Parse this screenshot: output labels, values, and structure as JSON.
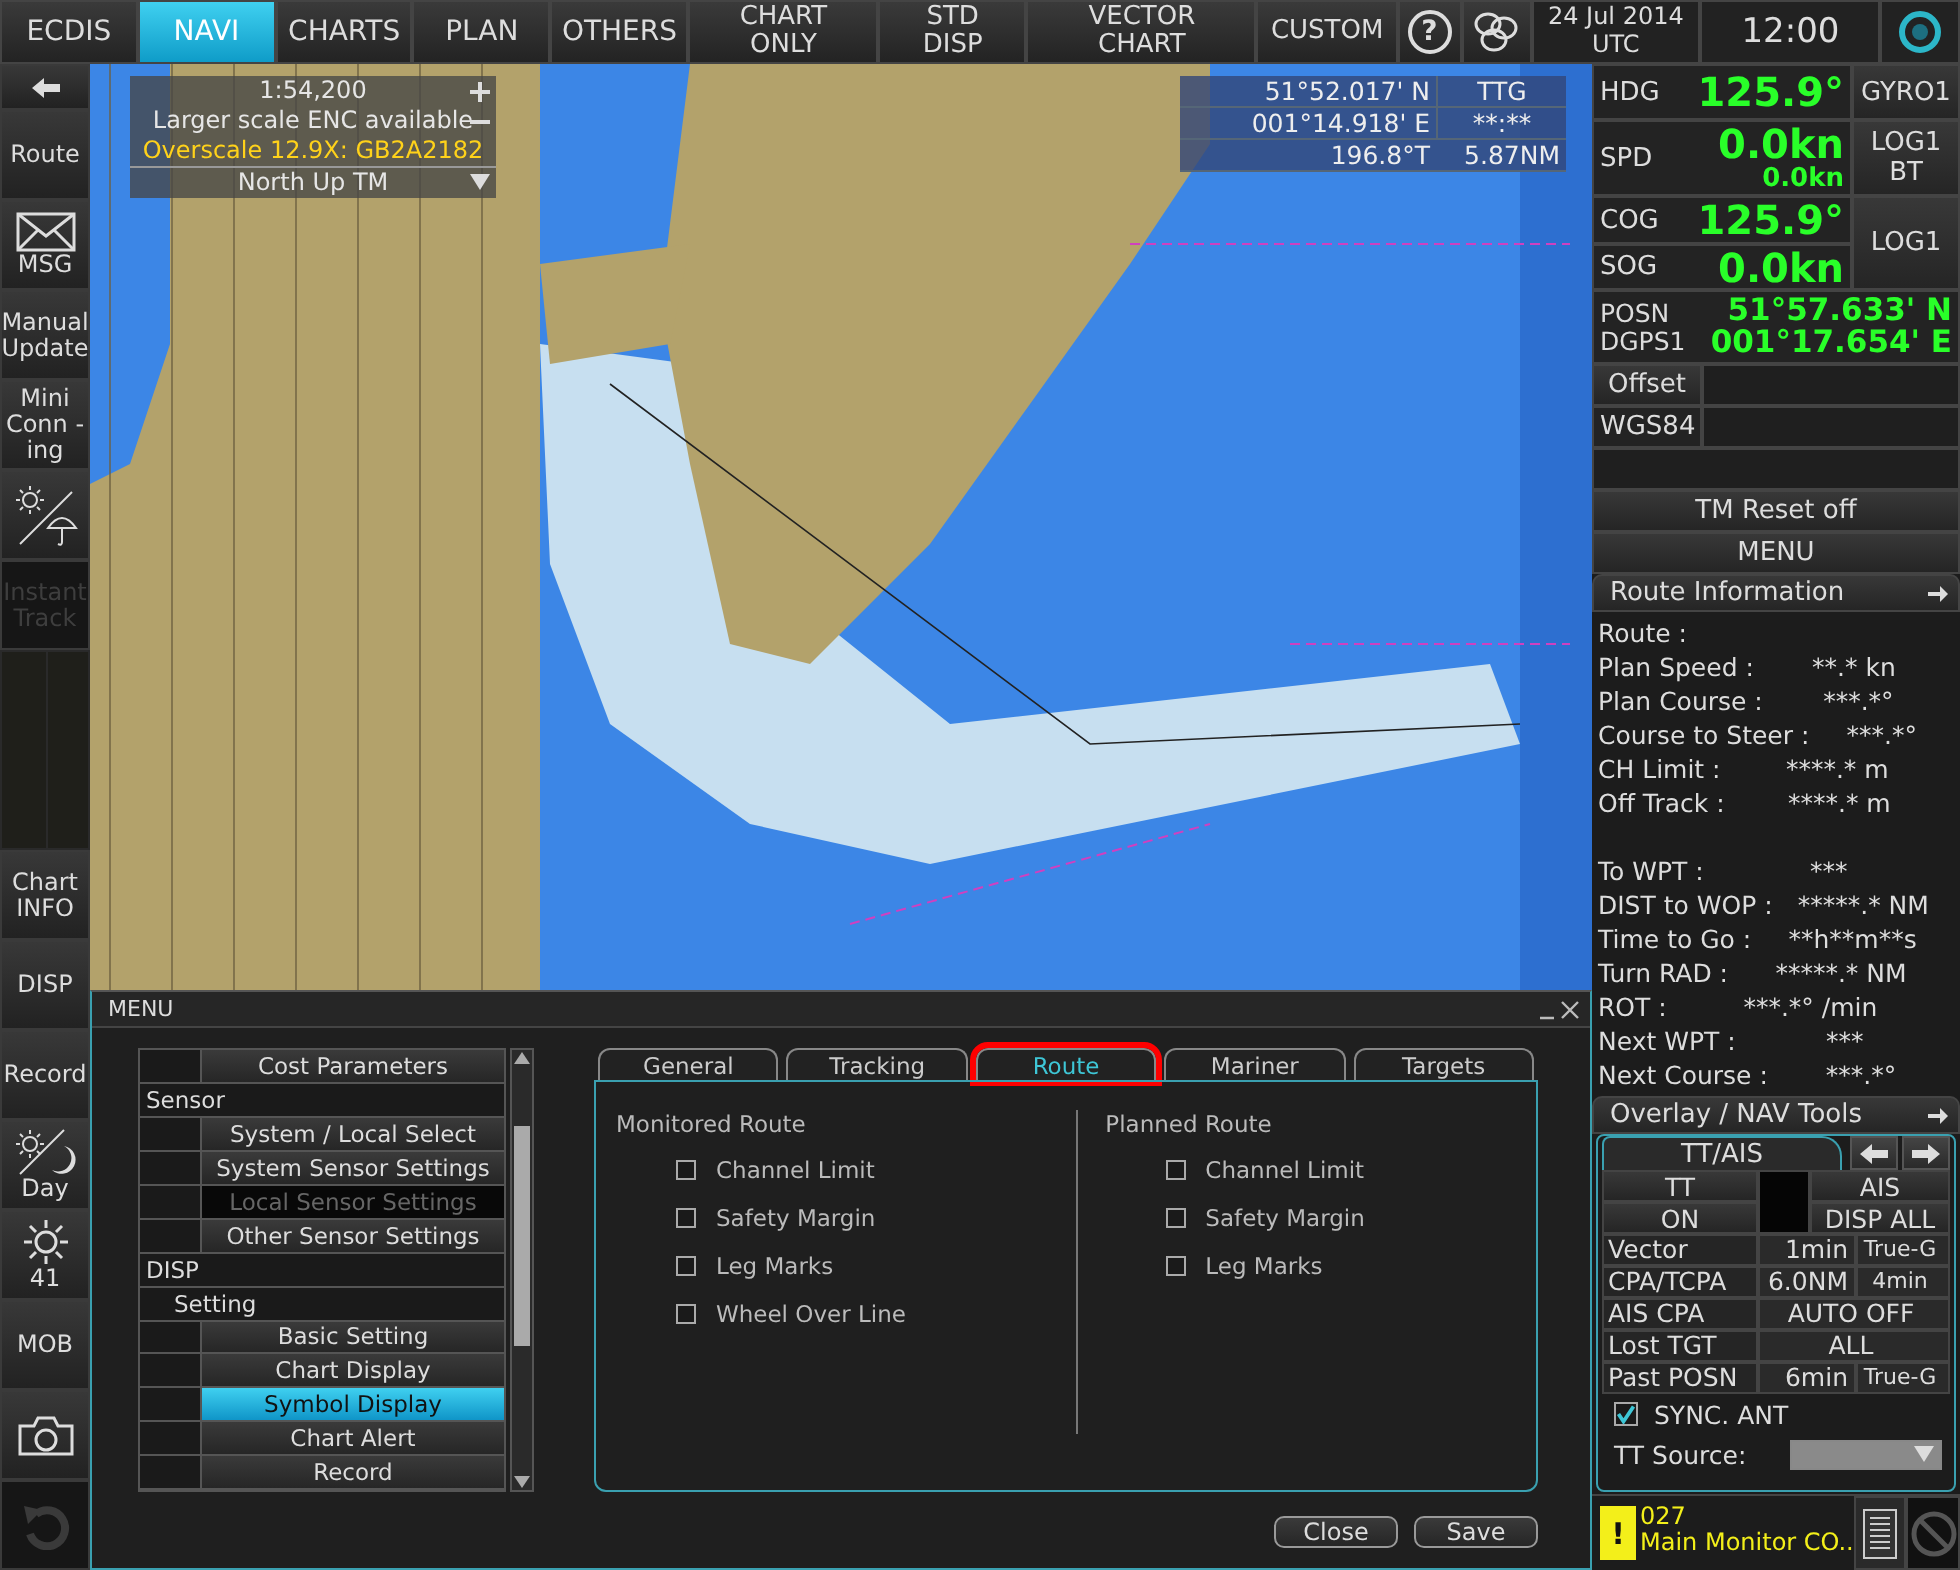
{
  "top_bar": {
    "tabs": [
      {
        "label": "ECDIS",
        "selected": false
      },
      {
        "label": "NAVI",
        "selected": true
      },
      {
        "label": "CHARTS",
        "selected": false
      },
      {
        "label": "PLAN",
        "selected": false
      },
      {
        "label": "OTHERS",
        "selected": false
      }
    ],
    "display_buttons": [
      "CHART ONLY",
      "STD DISP",
      "VECTOR CHART",
      "CUSTOM"
    ],
    "help_button": "?",
    "date": "24 Jul 2014",
    "timezone": "UTC",
    "time": "12:00"
  },
  "left_sidebar": {
    "upper_buttons": [
      {
        "kind": "arrow",
        "disabled": false
      },
      {
        "kind": "text",
        "label": "Route",
        "disabled": false
      },
      {
        "kind": "mail",
        "label": "MSG",
        "disabled": false
      },
      {
        "kind": "text",
        "label": "Manual Update",
        "disabled": false
      },
      {
        "kind": "text",
        "label": "Mini Conn -ing",
        "disabled": false
      },
      {
        "kind": "weather",
        "disabled": false
      },
      {
        "kind": "text",
        "label": "Instant Track",
        "disabled": true
      }
    ],
    "lower_buttons": [
      {
        "kind": "text",
        "label": "Chart INFO",
        "disabled": false
      },
      {
        "kind": "text",
        "label": "DISP",
        "disabled": false
      },
      {
        "kind": "text",
        "label": "Record",
        "disabled": false
      },
      {
        "kind": "daynight",
        "label": "Day",
        "disabled": false
      },
      {
        "kind": "brightness",
        "label": "41",
        "disabled": false
      },
      {
        "kind": "text",
        "label": "MOB",
        "disabled": false
      },
      {
        "kind": "camera",
        "disabled": false
      },
      {
        "kind": "undo",
        "disabled": true
      }
    ]
  },
  "chart": {
    "scale_box": {
      "scale": "1:54,200",
      "notice": "Larger scale ENC available",
      "overscale": "Overscale 12.9X: GB2A2182",
      "orientation": "North Up TM"
    },
    "cursor_box": {
      "lat": "51°52.017' N",
      "lon": "001°14.918' E",
      "bearing": "196.8°T",
      "range": "5.87NM",
      "ttg_label": "TTG",
      "ttg": "**:**"
    }
  },
  "sensors": {
    "hdg": {
      "label": "HDG",
      "value": "125.9°",
      "source": "GYRO1"
    },
    "spd": {
      "label": "SPD",
      "value": "0.0kn",
      "sub_value": "0.0kn",
      "source": "LOG1 BT"
    },
    "cog": {
      "label": "COG",
      "value": "125.9°"
    },
    "sog": {
      "label": "SOG",
      "value": "0.0kn"
    },
    "cog_sog_source": "LOG1",
    "position": {
      "label": "POSN",
      "source": "DGPS1",
      "lat": "51°57.633' N",
      "lon": "001°17.654' E"
    },
    "offset_button": "Offset",
    "datum": "WGS84"
  },
  "tm_reset_button": "TM Reset off",
  "menu_button": "MENU",
  "route_information": {
    "title": "Route Information",
    "rows": [
      {
        "label": "Route :"
      },
      {
        "label": "Plan Speed :",
        "value": "**.* kn"
      },
      {
        "label": "Plan Course :",
        "value": "***.*°"
      },
      {
        "label": "Course to Steer :",
        "value": "***.*°"
      },
      {
        "label": "CH Limit :",
        "value": "****.* m"
      },
      {
        "label": "Off Track :",
        "value": "****.* m"
      }
    ],
    "waypoint_rows": [
      {
        "label": "To WPT :",
        "value": "***"
      },
      {
        "label": "DIST to WOP :",
        "value": "*****.* NM"
      },
      {
        "label": "Time to Go :",
        "value": "**h**m**s"
      },
      {
        "label": "Turn RAD :",
        "value": "*****.* NM"
      },
      {
        "label": "ROT :",
        "value": "***.*° /min"
      },
      {
        "label": "Next WPT :",
        "value": "***"
      },
      {
        "label": "Next Course :",
        "value": "***.*°"
      }
    ]
  },
  "overlay_nav_tools": {
    "title": "Overlay / NAV Tools",
    "tab": "TT/AIS",
    "toggles": [
      {
        "label": "TT",
        "state": "ON"
      },
      {
        "label": "AIS",
        "state": "DISP ALL"
      }
    ],
    "settings": [
      {
        "label": "Vector",
        "values": [
          "1min",
          "True-G"
        ]
      },
      {
        "label": "CPA/TCPA",
        "values": [
          "6.0NM",
          "4min"
        ]
      },
      {
        "label": "AIS CPA",
        "values": [
          "AUTO OFF"
        ]
      },
      {
        "label": "Lost TGT",
        "values": [
          "ALL"
        ]
      },
      {
        "label": "Past POSN",
        "values": [
          "6min",
          "True-G"
        ]
      }
    ],
    "sync_ant": {
      "label": "SYNC. ANT",
      "checked": true
    },
    "tt_source": {
      "label": "TT Source:"
    }
  },
  "alert": {
    "icon": "!",
    "code": "027",
    "message": "Main Monitor CO.."
  },
  "menu_dialog": {
    "title": "MENU",
    "tree": [
      {
        "label": "Cost Parameters",
        "selected": false,
        "disabled": false
      },
      {
        "label": "Sensor",
        "selected": false,
        "disabled": false,
        "children": [
          {
            "label": "System / Local Select",
            "selected": false,
            "disabled": false
          },
          {
            "label": "System Sensor Settings",
            "selected": false,
            "disabled": false
          },
          {
            "label": "Local Sensor Settings",
            "selected": false,
            "disabled": true
          },
          {
            "label": "Other Sensor Settings",
            "selected": false,
            "disabled": false
          }
        ]
      },
      {
        "label": "DISP",
        "selected": false,
        "disabled": false,
        "children": [
          {
            "label": "Setting",
            "selected": false,
            "disabled": false,
            "children": [
              {
                "label": "Basic Setting",
                "selected": false,
                "disabled": false
              },
              {
                "label": "Chart Display",
                "selected": false,
                "disabled": false
              },
              {
                "label": "Symbol Display",
                "selected": true,
                "disabled": false
              },
              {
                "label": "Chart Alert",
                "selected": false,
                "disabled": false
              }
            ]
          }
        ]
      },
      {
        "label": "Record",
        "selected": false,
        "disabled": false
      }
    ],
    "tabs": [
      {
        "label": "General",
        "selected": false,
        "highlighted": false
      },
      {
        "label": "Tracking",
        "selected": false,
        "highlighted": false
      },
      {
        "label": "Route",
        "selected": true,
        "highlighted": true
      },
      {
        "label": "Mariner",
        "selected": false,
        "highlighted": false
      },
      {
        "label": "Targets",
        "selected": false,
        "highlighted": false
      }
    ],
    "sections": [
      {
        "title": "Monitored Route",
        "options": [
          {
            "label": "Channel Limit",
            "checked": false
          },
          {
            "label": "Safety Margin",
            "checked": false
          },
          {
            "label": "Leg Marks",
            "checked": false
          },
          {
            "label": "Wheel Over Line",
            "checked": false
          }
        ]
      },
      {
        "title": "Planned Route",
        "options": [
          {
            "label": "Channel Limit",
            "checked": false
          },
          {
            "label": "Safety Margin",
            "checked": false
          },
          {
            "label": "Leg Marks",
            "checked": false
          }
        ]
      }
    ],
    "buttons": [
      "Close",
      "Save"
    ]
  }
}
